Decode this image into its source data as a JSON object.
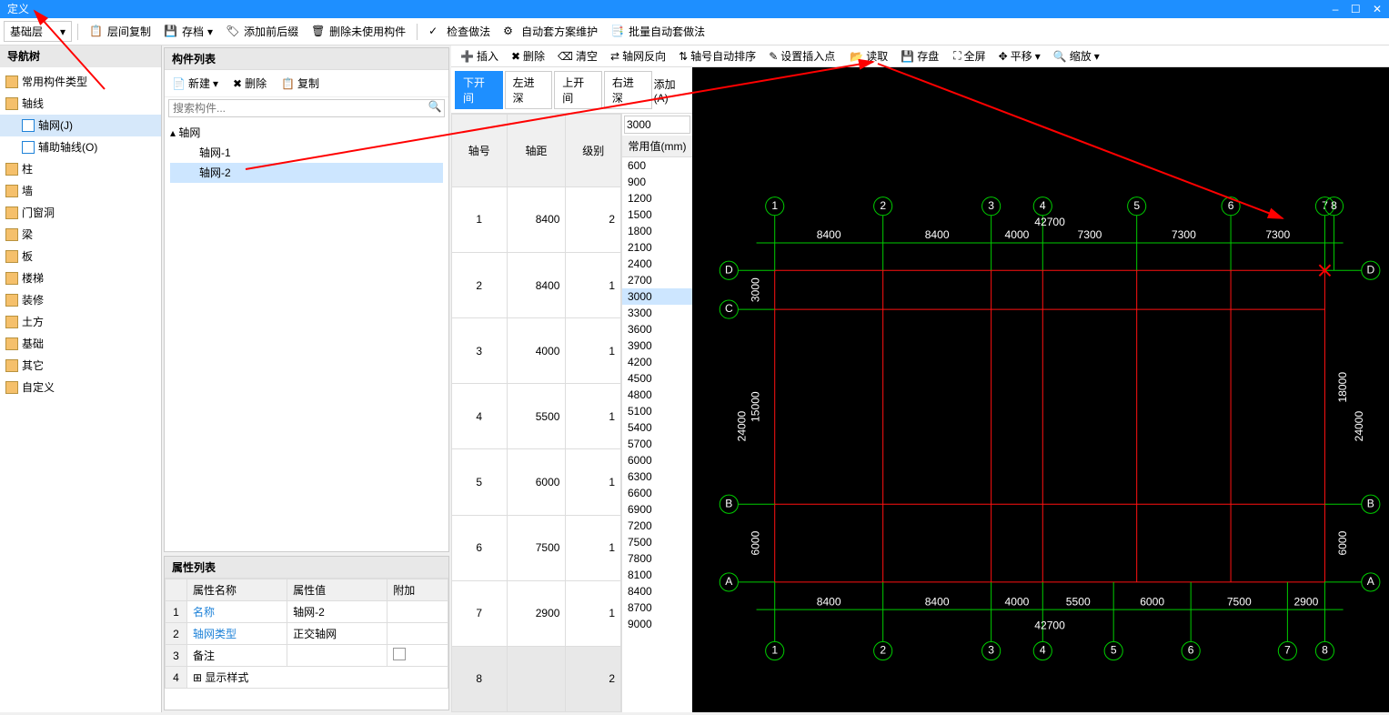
{
  "title": "定义",
  "tb1": {
    "layer": "基础层",
    "copy": "层间复制",
    "archive": "存档",
    "prefix": "添加前后缀",
    "delunused": "删除未使用构件",
    "check": "检查做法",
    "autoprac": "自动套方案维护",
    "batch": "批量自动套做法"
  },
  "nav": {
    "hdr": "导航树",
    "common": "常用构件类型",
    "axis": "轴线",
    "axisnet": "轴网(J)",
    "auxaxis": "辅助轴线(O)",
    "col": "柱",
    "wall": "墙",
    "door": "门窗洞",
    "beam": "梁",
    "slab": "板",
    "stair": "楼梯",
    "decor": "装修",
    "earth": "土方",
    "found": "基础",
    "other": "其它",
    "custom": "自定义"
  },
  "complist": {
    "hdr": "构件列表",
    "new": "新建",
    "del": "删除",
    "copy": "复制",
    "search": "搜索构件...",
    "root": "轴网",
    "c1": "轴网-1",
    "c2": "轴网-2"
  },
  "proplist": {
    "hdr": "属性列表",
    "h1": "属性名称",
    "h2": "属性值",
    "h3": "附加",
    "r1a": "名称",
    "r1b": "轴网-2",
    "r2a": "轴网类型",
    "r2b": "正交轴网",
    "r3a": "备注",
    "r4a": "显示样式"
  },
  "tb2": {
    "insert": "插入",
    "del": "删除",
    "clear": "清空",
    "reverse": "轴网反向",
    "autosort": "轴号自动排序",
    "setins": "设置插入点",
    "read": "读取",
    "save": "存盘",
    "full": "全屏",
    "pan": "平移",
    "zoom": "缩放"
  },
  "tabs": {
    "t1": "下开间",
    "t2": "左进深",
    "t3": "上开间",
    "t4": "右进深",
    "add": "添加(A)"
  },
  "axtbl": {
    "h1": "轴号",
    "h2": "轴距",
    "h3": "级别",
    "rows": [
      [
        "1",
        "8400",
        "2"
      ],
      [
        "2",
        "8400",
        "1"
      ],
      [
        "3",
        "4000",
        "1"
      ],
      [
        "4",
        "5500",
        "1"
      ],
      [
        "5",
        "6000",
        "1"
      ],
      [
        "6",
        "7500",
        "1"
      ],
      [
        "7",
        "2900",
        "1"
      ],
      [
        "8",
        "",
        "2"
      ]
    ]
  },
  "cv": {
    "inp": "3000",
    "hdr": "常用值(mm)",
    "vals": [
      "600",
      "900",
      "1200",
      "1500",
      "1800",
      "2100",
      "2400",
      "2700",
      "3000",
      "3300",
      "3600",
      "3900",
      "4200",
      "4500",
      "4800",
      "5100",
      "5400",
      "5700",
      "6000",
      "6300",
      "6600",
      "6900",
      "7200",
      "7500",
      "7800",
      "8100",
      "8400",
      "8700",
      "9000"
    ]
  },
  "canvas": {
    "topdims": [
      "8400",
      "8400",
      "4000",
      "7300",
      "7300",
      "7300"
    ],
    "topnums": [
      "1",
      "2",
      "3",
      "4",
      "5",
      "6",
      "7",
      "8"
    ],
    "toptotal": "42700",
    "botdims": [
      "8400",
      "8400",
      "4000",
      "5500",
      "6000",
      "7500",
      "2900"
    ],
    "botnums": [
      "1",
      "2",
      "3",
      "4",
      "5",
      "6",
      "7",
      "8"
    ],
    "bottotal": "42700",
    "leftdims": [
      "3000",
      "15000",
      "6000"
    ],
    "leftlbl": [
      "D",
      "C",
      "B",
      "A"
    ],
    "lefttotal": "24000",
    "rightdims": [
      "18000",
      "6000"
    ],
    "rightlbl": [
      "D",
      "B",
      "A"
    ],
    "righttotal": "24000"
  }
}
